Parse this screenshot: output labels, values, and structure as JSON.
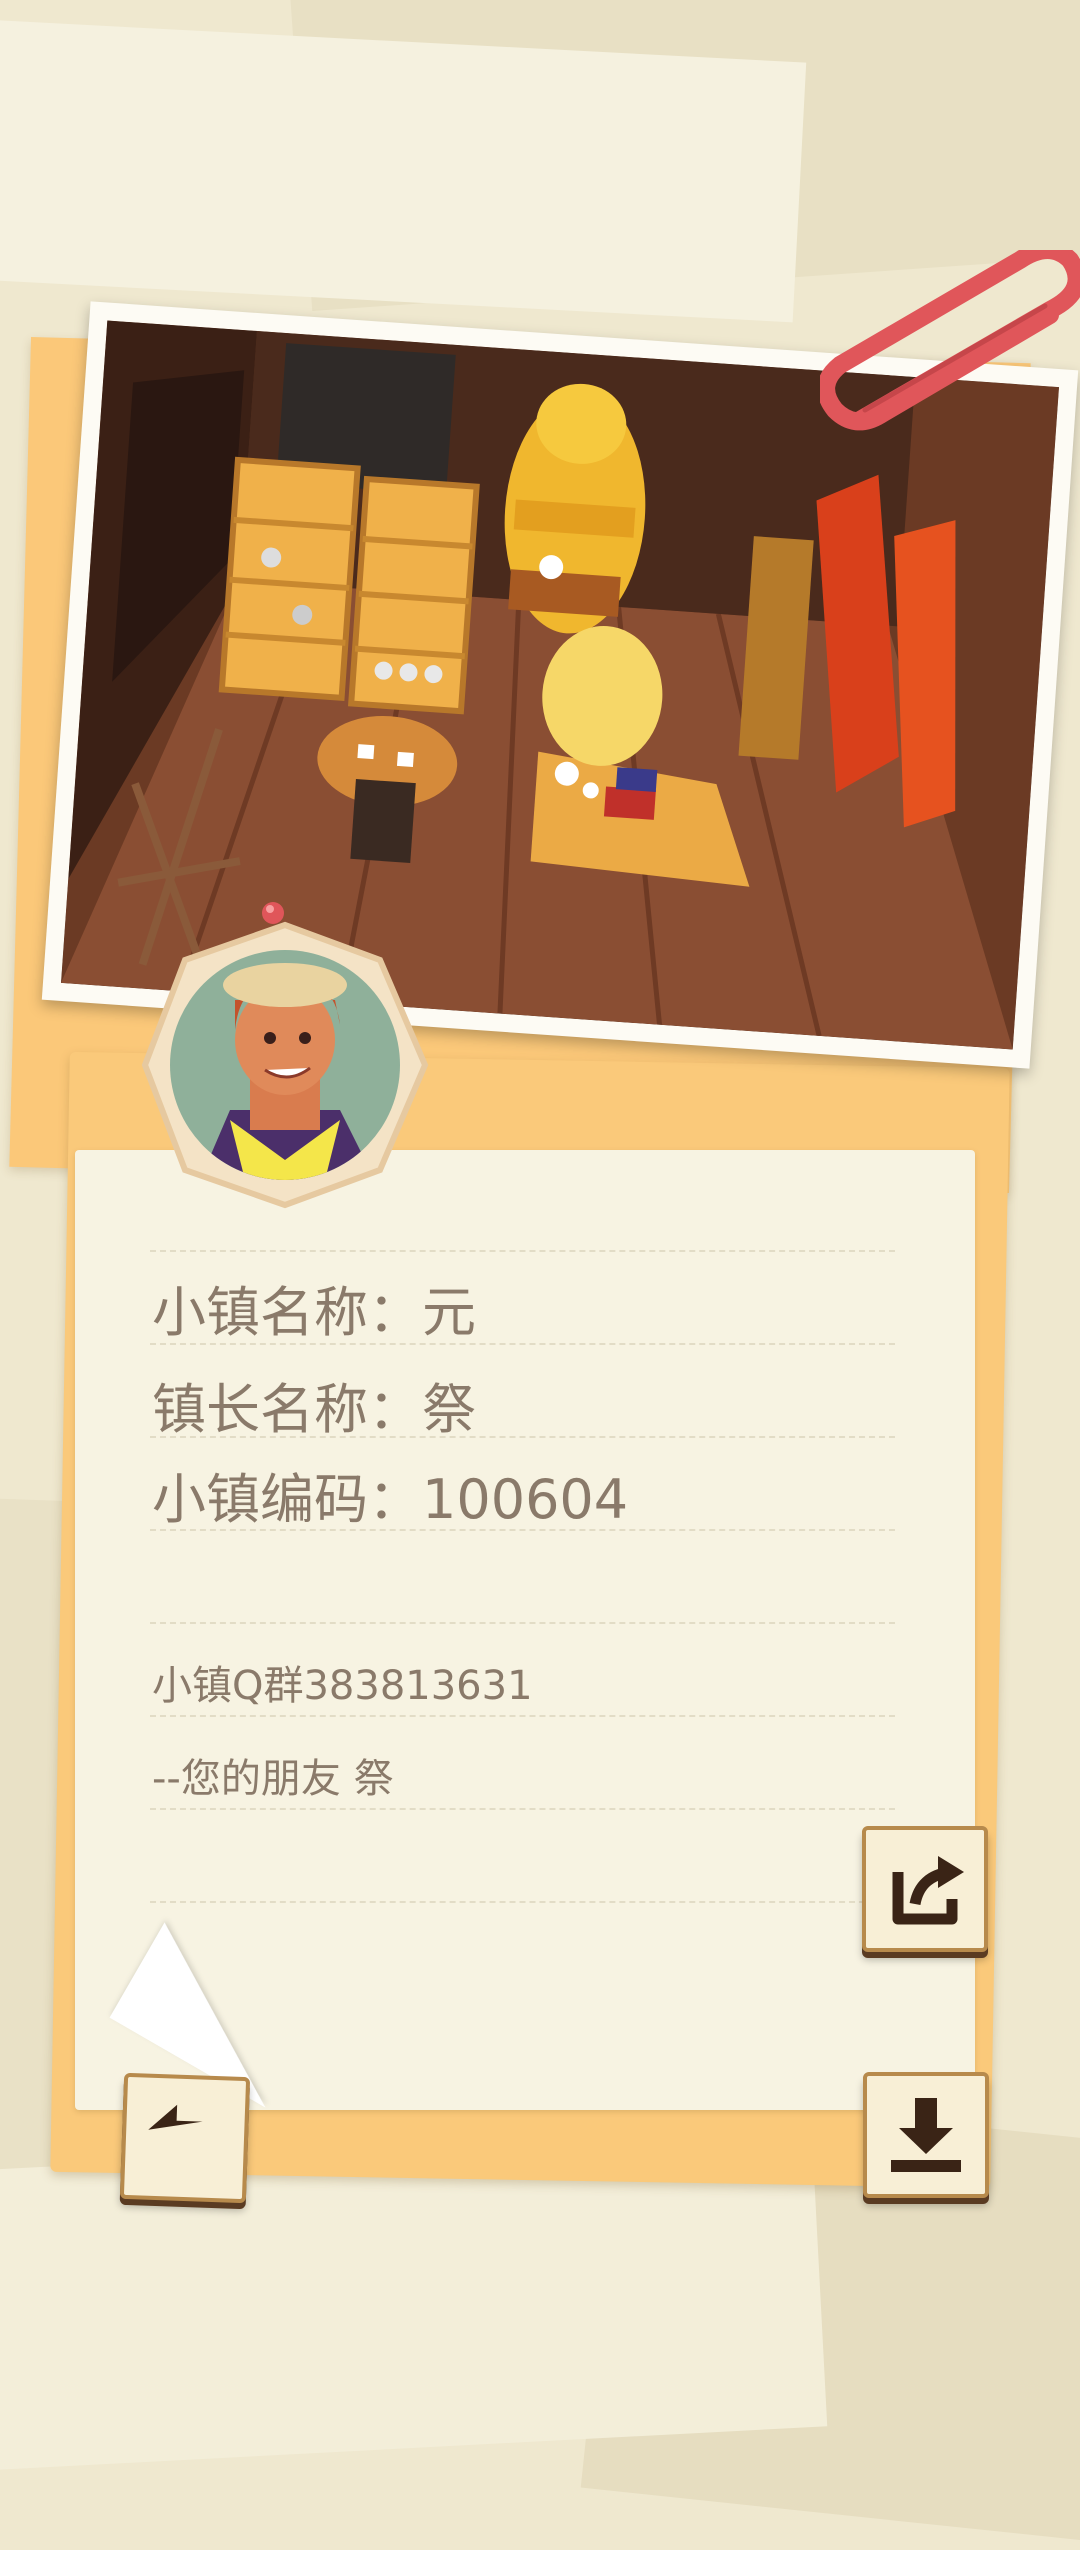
{
  "info": {
    "town_name": "小镇名称：元",
    "mayor_name": "镇长名称：祭",
    "town_code": "小镇编码：100604",
    "qq_group": "小镇Q群383813631",
    "signature": "--您的朋友 祭"
  },
  "buttons": {
    "share": "share-icon",
    "back": "back-arrow-icon",
    "download": "download-icon"
  },
  "colors": {
    "card_orange": "#fac97a",
    "paper": "#f7f3e2",
    "text": "#8a7a6a",
    "paperclip": "#e0565a"
  }
}
